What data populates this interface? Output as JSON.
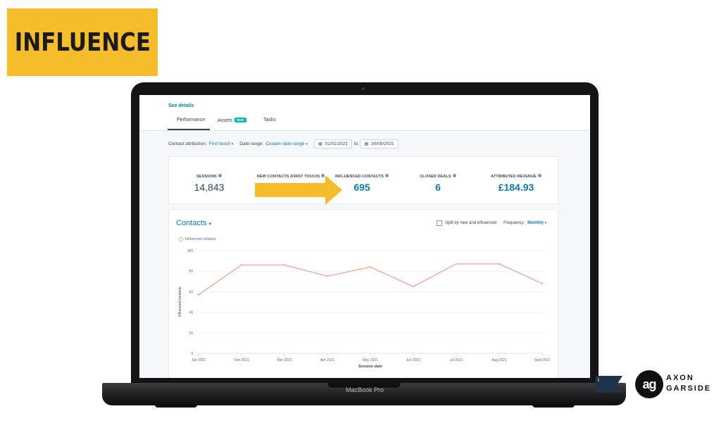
{
  "banner": {
    "title": "INFLUENCE"
  },
  "laptop": {
    "model_label": "MacBook Pro"
  },
  "report": {
    "see_details": "See details",
    "tabs": [
      {
        "label": "Performance",
        "active": true
      },
      {
        "label": "Assets",
        "badge": "NEW"
      },
      {
        "label": "Tasks"
      }
    ],
    "filters": {
      "attribution_label": "Contact attribution:",
      "attribution_value": "First touch",
      "date_range_label": "Date range:",
      "date_range_value": "Custom date range",
      "start_date": "01/01/2021",
      "to_label": "to",
      "end_date": "30/09/2021"
    },
    "stats": [
      {
        "label": "SESSIONS",
        "value": "14,843"
      },
      {
        "label": "NEW CONTACTS (FIRST TOUCH)",
        "value": ""
      },
      {
        "label": "INFLUENCED CONTACTS",
        "value": "695"
      },
      {
        "label": "CLOSED DEALS",
        "value": "6"
      },
      {
        "label": "ATTRIBUTED REVENUE",
        "value": "£184.93"
      }
    ],
    "chart_section": {
      "title": "Contacts",
      "split_label": "Split by new and influenced",
      "frequency_label": "Frequency:",
      "frequency_value": "Monthly"
    }
  },
  "chart_data": {
    "type": "line",
    "title": "",
    "categories": [
      "Jan 2021",
      "Feb 2021",
      "Mar 2021",
      "Apr 2021",
      "May 2021",
      "Jun 2021",
      "Jul 2021",
      "Aug 2021",
      "Sept 2021"
    ],
    "series": [
      {
        "name": "Influenced contacts",
        "values": [
          57,
          86,
          86,
          75,
          84,
          65,
          87,
          87,
          68
        ],
        "color": "#f2a391"
      }
    ],
    "xlabel": "Session date",
    "ylabel": "Influenced contacts",
    "ylim": [
      0,
      100
    ],
    "yticks": [
      0,
      20,
      40,
      60,
      80,
      100
    ],
    "grid": true,
    "legend": "top-left"
  },
  "branding": {
    "partner_badge_text": "t",
    "logo_mark": "ag",
    "company_line1": "AXON",
    "company_line2": "GARSIDE"
  },
  "colors": {
    "banner": "#f6bd2b",
    "accent": "#0a7dab",
    "arrow": "#f6bd2b",
    "line": "#f2a391"
  }
}
